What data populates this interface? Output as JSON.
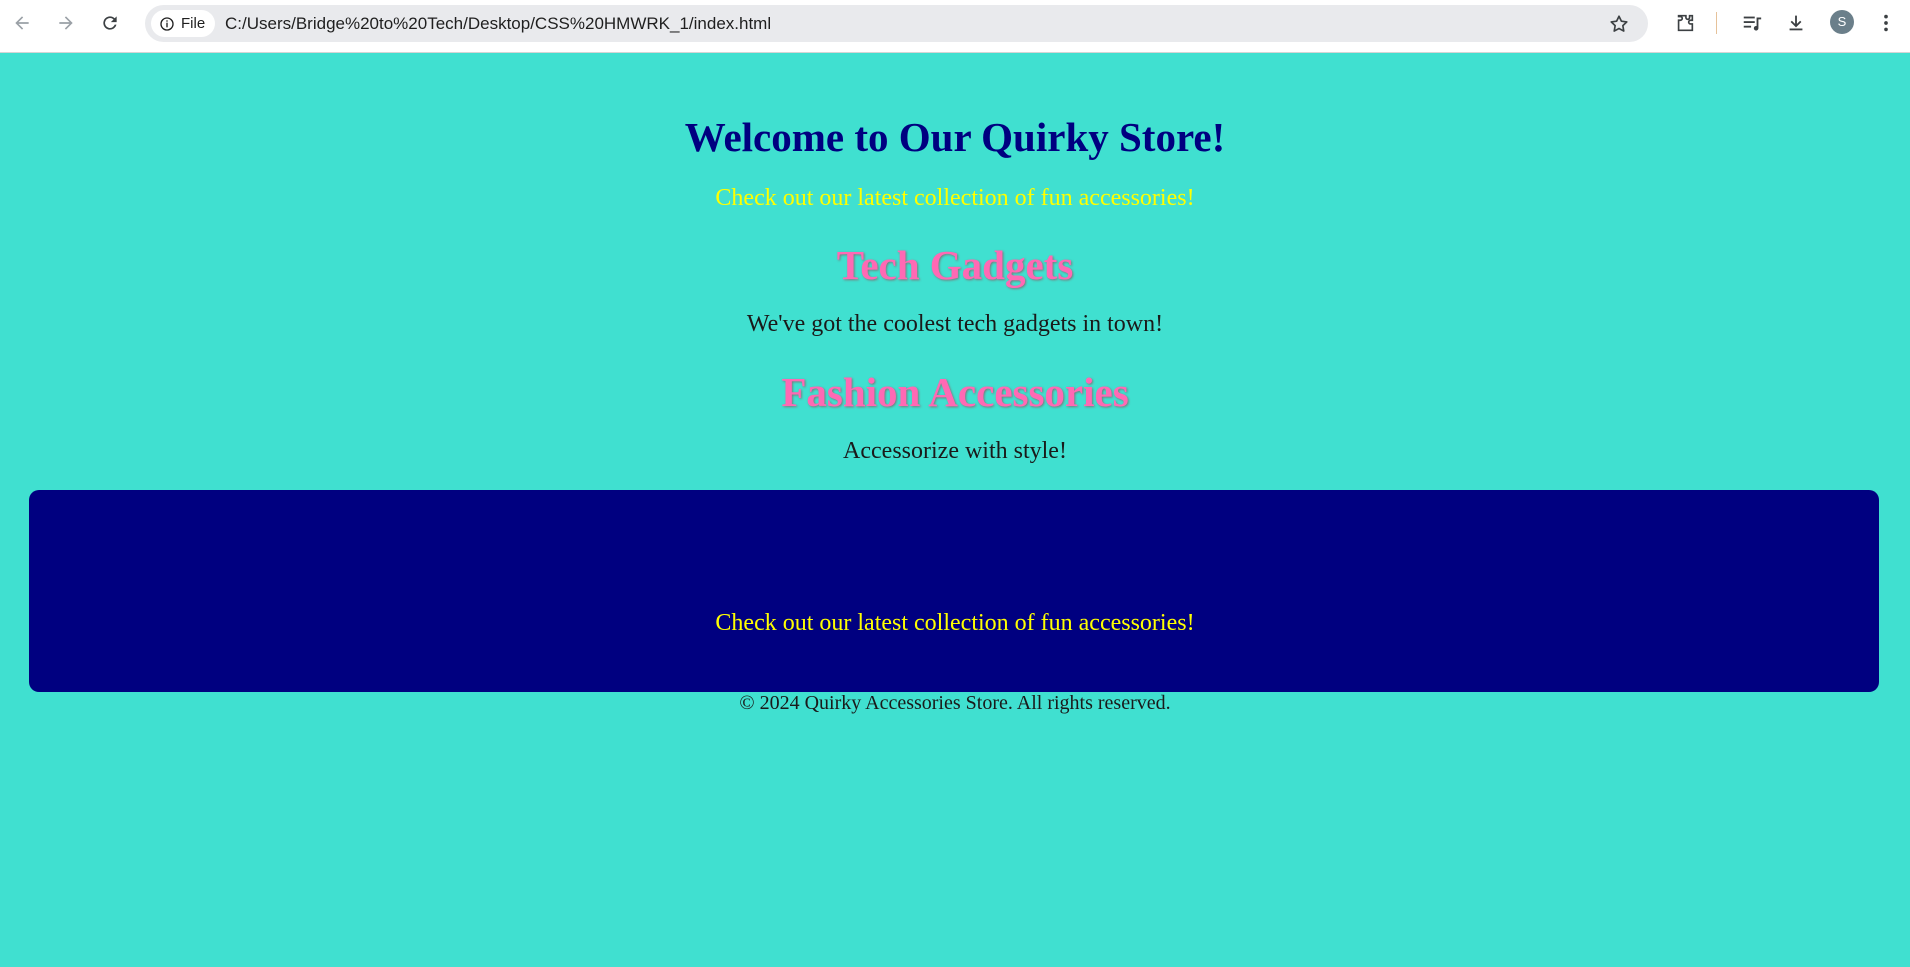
{
  "browser": {
    "site_chip_label": "File",
    "url": "C:/Users/Bridge%20to%20Tech/Desktop/CSS%20HMWRK_1/index.html",
    "profile_initial": "S",
    "icons": [
      "back-icon",
      "forward-icon",
      "reload-icon",
      "info-icon",
      "star-icon",
      "extensions-icon",
      "reading-list-icon",
      "download-icon",
      "menu-icon"
    ]
  },
  "page": {
    "title": "Welcome to Our Quirky Store!",
    "tagline": "Check out our latest collection of fun accessories!",
    "sections": [
      {
        "heading": "Tech Gadgets",
        "text": "We've got the coolest tech gadgets in town!"
      },
      {
        "heading": "Fashion Accessories",
        "text": "Accessorize with style!"
      }
    ],
    "banner_text": "Check out our latest collection of fun accessories!",
    "footer": "© 2024 Quirky Accessories Store. All rights reserved."
  },
  "colors": {
    "background": "#40e0d0",
    "title": "#000080",
    "tagline": "#ffff00",
    "heading": "#ff69b4",
    "banner": "#000080"
  }
}
